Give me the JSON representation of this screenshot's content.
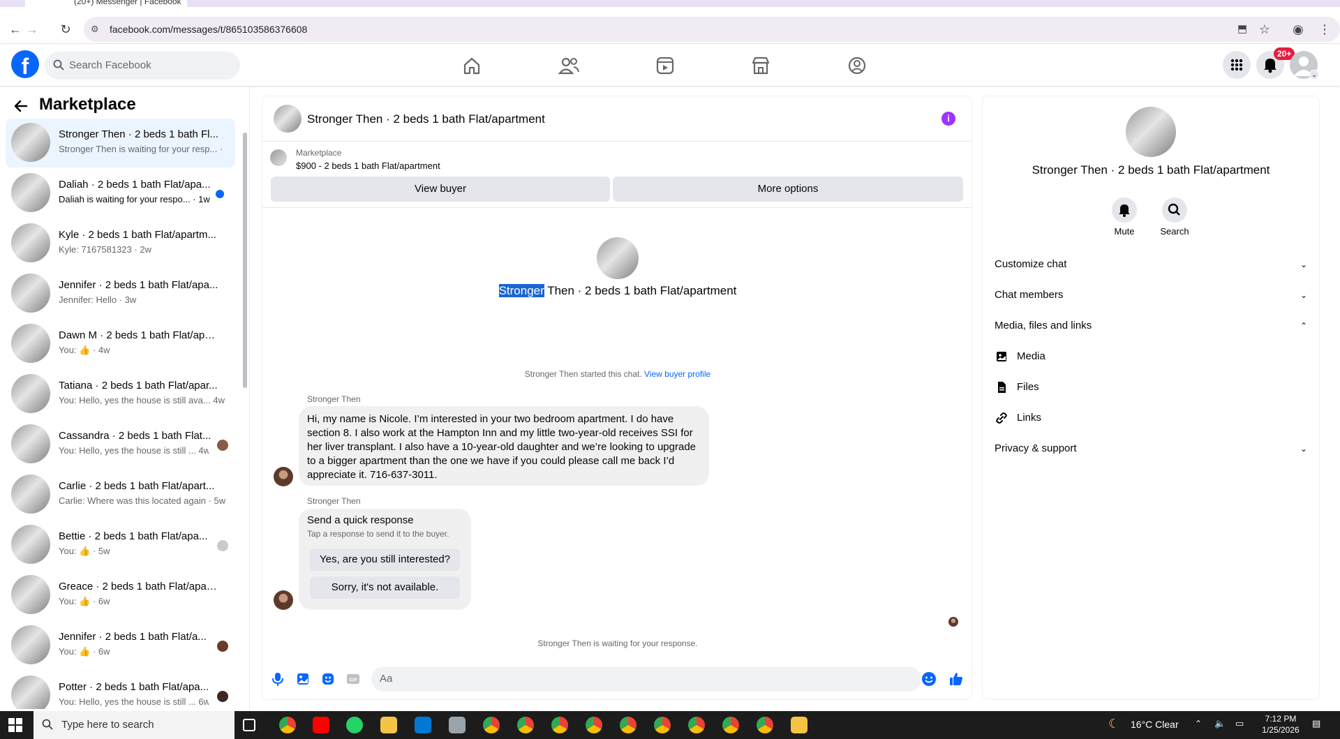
{
  "browser": {
    "tab_title": "(20+) Messenger | Facebook",
    "url": "facebook.com/messages/t/865103586376608"
  },
  "header": {
    "search_placeholder": "Search Facebook",
    "notification_badge": "20+"
  },
  "sidebar": {
    "title": "Marketplace",
    "conversations": [
      {
        "name": "Stronger Then · 2 beds 1 bath Fl...",
        "preview": "Stronger Then is waiting for your resp... ·"
      },
      {
        "name": "Daliah · 2 beds 1 bath Flat/apa...",
        "preview": "Daliah is waiting for your respo... · 1w"
      },
      {
        "name": "Kyle · 2 beds 1 bath Flat/apartm...",
        "preview": "Kyle: 7167581323 · 2w"
      },
      {
        "name": "Jennifer · 2 beds 1 bath Flat/apa...",
        "preview": "Jennifer: Hello · 3w"
      },
      {
        "name": "Dawn M · 2 beds 1 bath Flat/apa...",
        "preview": "You: 👍 · 4w"
      },
      {
        "name": "Tatiana · 2 beds 1 bath Flat/apar...",
        "preview": "You: Hello, yes the house is still ava... 4w"
      },
      {
        "name": "Cassandra · 2 beds 1 bath Flat...",
        "preview": "You: Hello, yes the house is still ... 4w"
      },
      {
        "name": "Carlie · 2 beds 1 bath Flat/apart...",
        "preview": "Carlie: Where was this located again · 5w"
      },
      {
        "name": "Bettie · 2 beds 1 bath Flat/apa...",
        "preview": "You: 👍 · 5w"
      },
      {
        "name": "Greace · 2 beds 1 bath Flat/apart...",
        "preview": "You: 👍 · 6w"
      },
      {
        "name": "Jennifer · 2 beds 1 bath Flat/a...",
        "preview": "You: 👍 · 6w"
      },
      {
        "name": "Potter · 2 beds 1 bath Flat/apa...",
        "preview": "You: Hello, yes the house is still ... 6w"
      }
    ]
  },
  "chat": {
    "title": "Stronger Then · 2 beds 1 bath Flat/apartment",
    "marketplace_label": "Marketplace",
    "listing": "$900 - 2 beds 1 bath Flat/apartment",
    "view_buyer": "View buyer",
    "more_options": "More options",
    "profile_name_highlight": "Stronger",
    "profile_name_rest": " Then · 2 beds 1 bath Flat/apartment",
    "started_text": "Stronger Then started this chat.",
    "view_buyer_profile": "View buyer profile",
    "sender": "Stronger Then",
    "message_lines": [
      "Hi, my name is Nicole. I’m interested in your two bedroom apartment. I do have",
      "section 8. I also work at the Hampton Inn and my little two-year-old receives SSI for",
      "her liver transplant. I also have a 10-year-old daughter and we’re looking to upgrade",
      "to a bigger apartment than the one we have if you could please call me back I’d",
      "appreciate it. 716-637-3011."
    ],
    "quick_title": "Send a quick response",
    "quick_sub": "Tap a response to send it to the buyer.",
    "quick_1": "Yes, are you still interested?",
    "quick_2": "Sorry, it's not available.",
    "waiting": "Stronger Then is waiting for your response.",
    "composer_placeholder": "Aa"
  },
  "details": {
    "name": "Stronger Then · 2 beds 1 bath Flat/apartment",
    "mute": "Mute",
    "search": "Search",
    "customize": "Customize chat",
    "members": "Chat members",
    "media_section": "Media, files and links",
    "media": "Media",
    "files": "Files",
    "links": "Links",
    "privacy": "Privacy & support"
  },
  "taskbar": {
    "search_placeholder": "Type here to search",
    "weather": "16°C  Clear",
    "time": "7:12 PM",
    "date": "1/25/2026"
  },
  "colors": {
    "brand": "#0866ff",
    "accent_purple": "#a033ff",
    "badge": "#e41e3f"
  }
}
